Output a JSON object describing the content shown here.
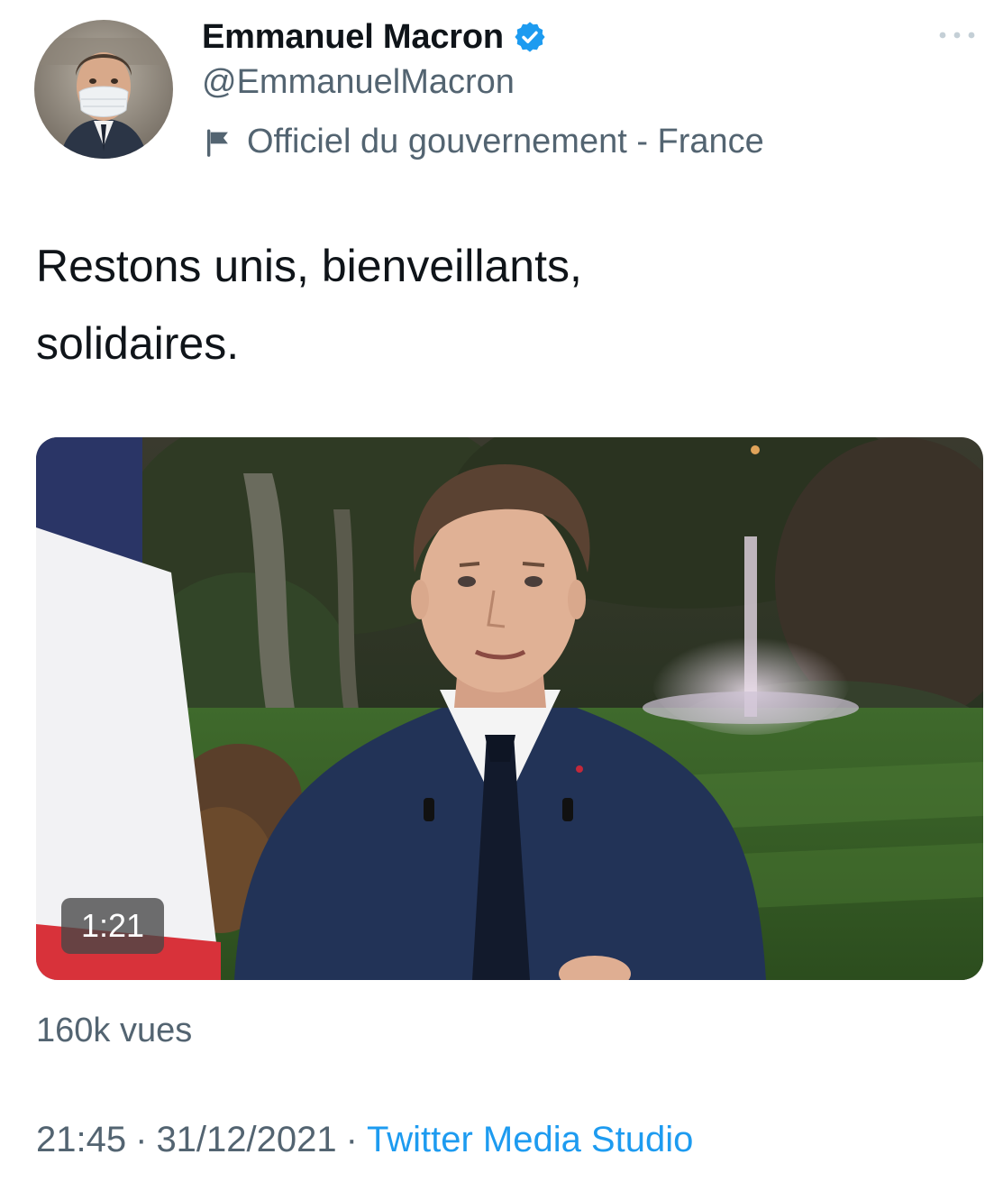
{
  "author": {
    "display_name": "Emmanuel Macron",
    "handle": "@EmmanuelMacron",
    "affiliation": "Officiel du gouvernement - France",
    "verified_icon": "verified-badge-icon",
    "affiliation_icon": "flag-icon"
  },
  "tweet": {
    "text": "Restons unis, bienveillants,\nsolidaires."
  },
  "media": {
    "type": "video",
    "duration": "1:21"
  },
  "stats": {
    "views": "160k vues"
  },
  "meta": {
    "time": "21:45",
    "separator": "·",
    "date": "31/12/2021",
    "source": "Twitter Media Studio"
  },
  "colors": {
    "text_primary": "#0f1419",
    "text_secondary": "#536471",
    "accent": "#1d9bf0"
  }
}
